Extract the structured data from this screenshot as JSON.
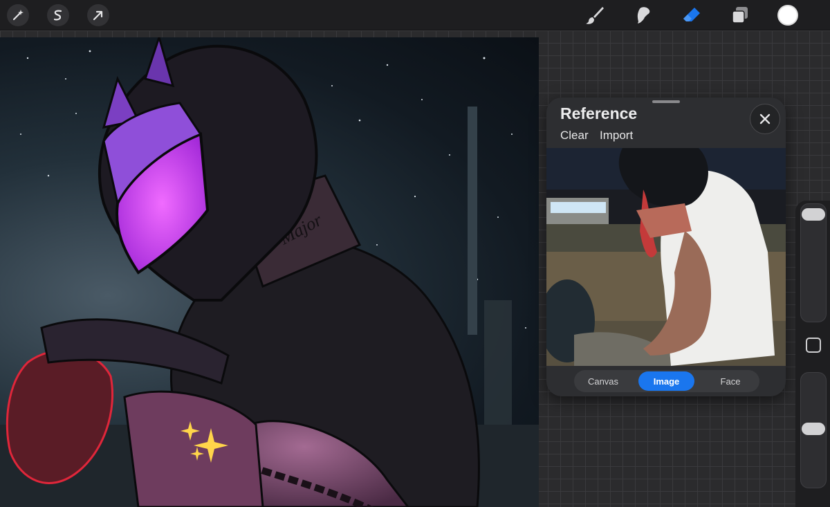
{
  "toolbar": {
    "left_icons": [
      "adjustments-wand-icon",
      "selection-s-icon",
      "transform-arrow-icon"
    ],
    "right_tools": [
      "brush-icon",
      "smudge-icon",
      "eraser-icon",
      "layers-icon"
    ],
    "active_tool": "eraser-icon",
    "active_color": "#ffffff",
    "accent_color": "#1a76ee"
  },
  "canvas": {
    "tattoo_text": "Major"
  },
  "reference": {
    "title": "Reference",
    "clear_label": "Clear",
    "import_label": "Import",
    "close_icon": "close-icon",
    "tabs": [
      {
        "label": "Canvas",
        "active": false
      },
      {
        "label": "Image",
        "active": true
      },
      {
        "label": "Face",
        "active": false
      }
    ]
  },
  "sidebar": {
    "brush_size_level": 0.95,
    "opacity_level": 0.55,
    "modify_button_icon": "square-modify-icon"
  }
}
